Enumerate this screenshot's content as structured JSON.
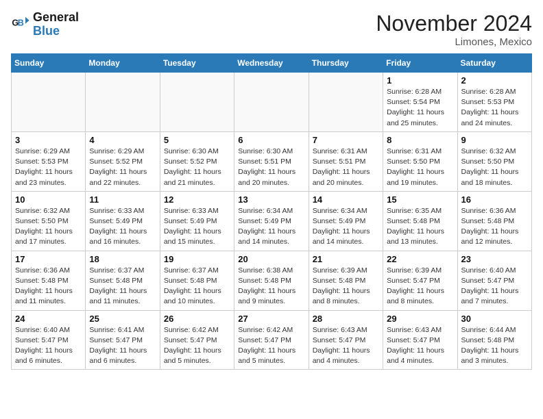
{
  "logo": {
    "line1": "General",
    "line2": "Blue"
  },
  "title": "November 2024",
  "location": "Limones, Mexico",
  "weekdays": [
    "Sunday",
    "Monday",
    "Tuesday",
    "Wednesday",
    "Thursday",
    "Friday",
    "Saturday"
  ],
  "weeks": [
    [
      {
        "day": "",
        "info": ""
      },
      {
        "day": "",
        "info": ""
      },
      {
        "day": "",
        "info": ""
      },
      {
        "day": "",
        "info": ""
      },
      {
        "day": "",
        "info": ""
      },
      {
        "day": "1",
        "info": "Sunrise: 6:28 AM\nSunset: 5:54 PM\nDaylight: 11 hours\nand 25 minutes."
      },
      {
        "day": "2",
        "info": "Sunrise: 6:28 AM\nSunset: 5:53 PM\nDaylight: 11 hours\nand 24 minutes."
      }
    ],
    [
      {
        "day": "3",
        "info": "Sunrise: 6:29 AM\nSunset: 5:53 PM\nDaylight: 11 hours\nand 23 minutes."
      },
      {
        "day": "4",
        "info": "Sunrise: 6:29 AM\nSunset: 5:52 PM\nDaylight: 11 hours\nand 22 minutes."
      },
      {
        "day": "5",
        "info": "Sunrise: 6:30 AM\nSunset: 5:52 PM\nDaylight: 11 hours\nand 21 minutes."
      },
      {
        "day": "6",
        "info": "Sunrise: 6:30 AM\nSunset: 5:51 PM\nDaylight: 11 hours\nand 20 minutes."
      },
      {
        "day": "7",
        "info": "Sunrise: 6:31 AM\nSunset: 5:51 PM\nDaylight: 11 hours\nand 20 minutes."
      },
      {
        "day": "8",
        "info": "Sunrise: 6:31 AM\nSunset: 5:50 PM\nDaylight: 11 hours\nand 19 minutes."
      },
      {
        "day": "9",
        "info": "Sunrise: 6:32 AM\nSunset: 5:50 PM\nDaylight: 11 hours\nand 18 minutes."
      }
    ],
    [
      {
        "day": "10",
        "info": "Sunrise: 6:32 AM\nSunset: 5:50 PM\nDaylight: 11 hours\nand 17 minutes."
      },
      {
        "day": "11",
        "info": "Sunrise: 6:33 AM\nSunset: 5:49 PM\nDaylight: 11 hours\nand 16 minutes."
      },
      {
        "day": "12",
        "info": "Sunrise: 6:33 AM\nSunset: 5:49 PM\nDaylight: 11 hours\nand 15 minutes."
      },
      {
        "day": "13",
        "info": "Sunrise: 6:34 AM\nSunset: 5:49 PM\nDaylight: 11 hours\nand 14 minutes."
      },
      {
        "day": "14",
        "info": "Sunrise: 6:34 AM\nSunset: 5:49 PM\nDaylight: 11 hours\nand 14 minutes."
      },
      {
        "day": "15",
        "info": "Sunrise: 6:35 AM\nSunset: 5:48 PM\nDaylight: 11 hours\nand 13 minutes."
      },
      {
        "day": "16",
        "info": "Sunrise: 6:36 AM\nSunset: 5:48 PM\nDaylight: 11 hours\nand 12 minutes."
      }
    ],
    [
      {
        "day": "17",
        "info": "Sunrise: 6:36 AM\nSunset: 5:48 PM\nDaylight: 11 hours\nand 11 minutes."
      },
      {
        "day": "18",
        "info": "Sunrise: 6:37 AM\nSunset: 5:48 PM\nDaylight: 11 hours\nand 11 minutes."
      },
      {
        "day": "19",
        "info": "Sunrise: 6:37 AM\nSunset: 5:48 PM\nDaylight: 11 hours\nand 10 minutes."
      },
      {
        "day": "20",
        "info": "Sunrise: 6:38 AM\nSunset: 5:48 PM\nDaylight: 11 hours\nand 9 minutes."
      },
      {
        "day": "21",
        "info": "Sunrise: 6:39 AM\nSunset: 5:48 PM\nDaylight: 11 hours\nand 8 minutes."
      },
      {
        "day": "22",
        "info": "Sunrise: 6:39 AM\nSunset: 5:47 PM\nDaylight: 11 hours\nand 8 minutes."
      },
      {
        "day": "23",
        "info": "Sunrise: 6:40 AM\nSunset: 5:47 PM\nDaylight: 11 hours\nand 7 minutes."
      }
    ],
    [
      {
        "day": "24",
        "info": "Sunrise: 6:40 AM\nSunset: 5:47 PM\nDaylight: 11 hours\nand 6 minutes."
      },
      {
        "day": "25",
        "info": "Sunrise: 6:41 AM\nSunset: 5:47 PM\nDaylight: 11 hours\nand 6 minutes."
      },
      {
        "day": "26",
        "info": "Sunrise: 6:42 AM\nSunset: 5:47 PM\nDaylight: 11 hours\nand 5 minutes."
      },
      {
        "day": "27",
        "info": "Sunrise: 6:42 AM\nSunset: 5:47 PM\nDaylight: 11 hours\nand 5 minutes."
      },
      {
        "day": "28",
        "info": "Sunrise: 6:43 AM\nSunset: 5:47 PM\nDaylight: 11 hours\nand 4 minutes."
      },
      {
        "day": "29",
        "info": "Sunrise: 6:43 AM\nSunset: 5:47 PM\nDaylight: 11 hours\nand 4 minutes."
      },
      {
        "day": "30",
        "info": "Sunrise: 6:44 AM\nSunset: 5:48 PM\nDaylight: 11 hours\nand 3 minutes."
      }
    ]
  ]
}
